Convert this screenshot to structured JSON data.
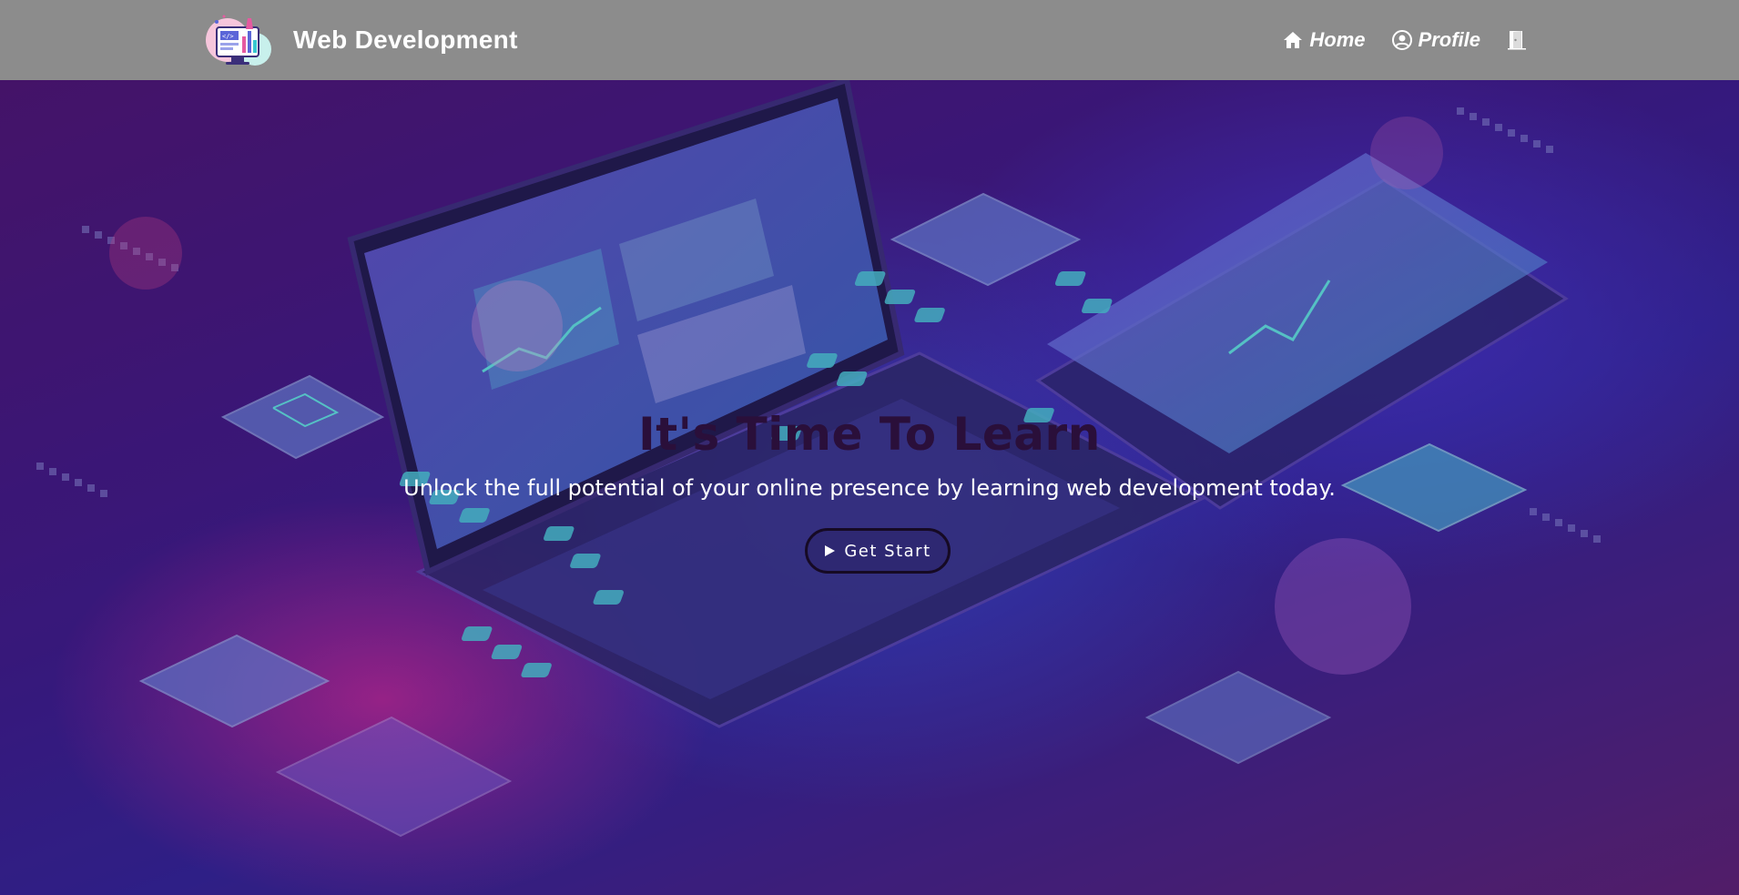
{
  "navbar": {
    "brand_title": "Web Development",
    "links": [
      {
        "label": "Home",
        "icon": "home-icon"
      },
      {
        "label": "Profile",
        "icon": "user-circle-icon"
      },
      {
        "label": "",
        "icon": "door-icon"
      }
    ],
    "background_color": "#8c8c8c"
  },
  "hero": {
    "title": "It's Time To Learn",
    "subtitle": "Unlock the full potential of your online presence by learning web development today.",
    "cta_label": "Get Start",
    "cta_icon": "play-icon",
    "title_color": "#2a0f3a",
    "accent_colors": [
      "#d62896",
      "#3f3ad8",
      "#38c8d0"
    ]
  }
}
